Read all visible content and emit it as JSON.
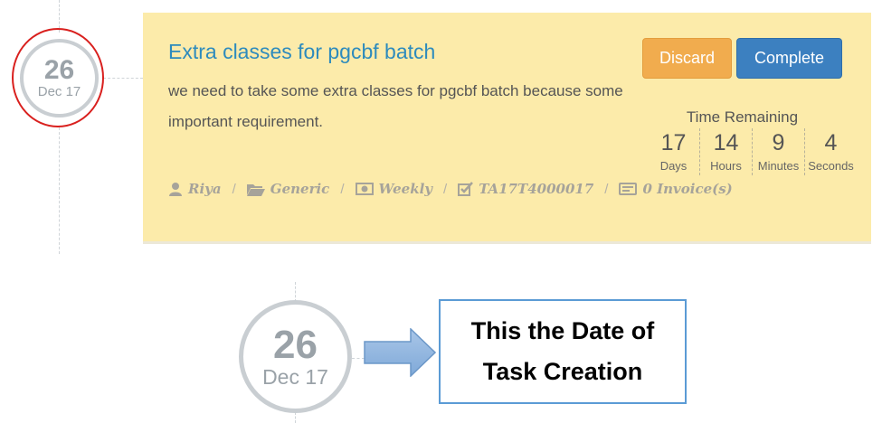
{
  "task": {
    "date_day": "26",
    "date_month": "Dec 17",
    "title": "Extra classes for pgcbf batch",
    "description": "we need to take some extra classes for pgcbf batch because some important requirement.",
    "buttons": {
      "discard": "Discard",
      "complete": "Complete"
    },
    "time_remaining": {
      "label": "Time Remaining",
      "cells": [
        {
          "value": "17",
          "unit": "Days"
        },
        {
          "value": "14",
          "unit": "Hours"
        },
        {
          "value": "9",
          "unit": "Minutes"
        },
        {
          "value": "4",
          "unit": "Seconds"
        }
      ]
    },
    "meta": {
      "user": "Riya",
      "category": "Generic",
      "frequency": "Weekly",
      "task_id": "TA17T4000017",
      "invoices": "0 Invoice(s)"
    }
  },
  "annotation": {
    "date_day": "26",
    "date_month": "Dec 17",
    "callout_text": "This the Date of Task Creation"
  },
  "colors": {
    "card_bg": "#fcebaa",
    "title": "#2d8bbd",
    "discard": "#f1ac4e",
    "complete": "#3c80c0",
    "highlight_ring": "#d9201e",
    "callout_border": "#5b9bd5"
  },
  "icons": [
    "user-icon",
    "folder-icon",
    "money-icon",
    "checkbox-icon",
    "invoice-icon",
    "arrow-right-icon"
  ]
}
